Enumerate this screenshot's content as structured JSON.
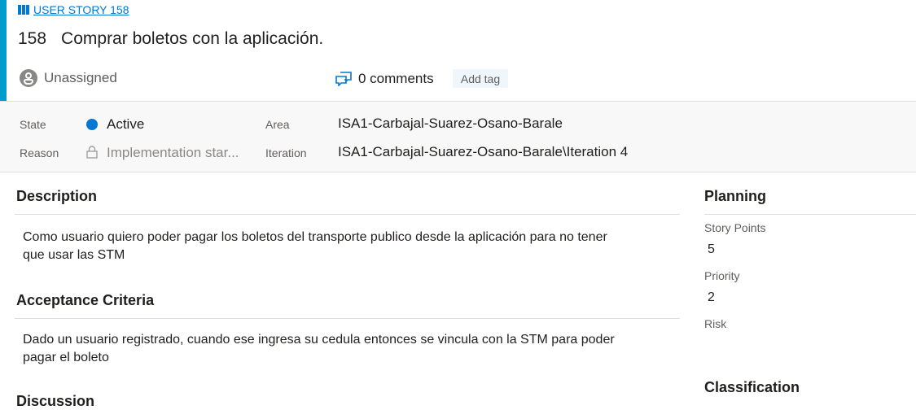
{
  "work_item": {
    "type_label": "USER STORY 158",
    "id": "158",
    "title": "Comprar boletos con la aplicación."
  },
  "header": {
    "assignee": "Unassigned",
    "comments_label": "0 comments",
    "add_tag_label": "Add tag"
  },
  "fields": {
    "state_label": "State",
    "state_value": "Active",
    "reason_label": "Reason",
    "reason_value": "Implementation star...",
    "area_label": "Area",
    "area_value": "ISA1-Carbajal-Suarez-Osano-Barale",
    "iteration_label": "Iteration",
    "iteration_value": "ISA1-Carbajal-Suarez-Osano-Barale\\Iteration 4"
  },
  "description": {
    "heading": "Description",
    "line1": "Como usuario quiero poder pagar los boletos del transporte publico desde la aplicación para no tener",
    "line2": "que usar las STM"
  },
  "acceptance": {
    "heading": "Acceptance Criteria",
    "line1": "Dado un usuario registrado, cuando ese ingresa su cedula entonces se vincula con la STM para poder",
    "line2": "pagar el boleto"
  },
  "discussion": {
    "heading": "Discussion"
  },
  "planning": {
    "heading": "Planning",
    "story_points_label": "Story Points",
    "story_points_value": "5",
    "priority_label": "Priority",
    "priority_value": "2",
    "risk_label": "Risk"
  },
  "classification": {
    "heading": "Classification"
  },
  "colors": {
    "accent": "#009ccc",
    "link": "#0078d4",
    "state_active": "#0078d4"
  }
}
